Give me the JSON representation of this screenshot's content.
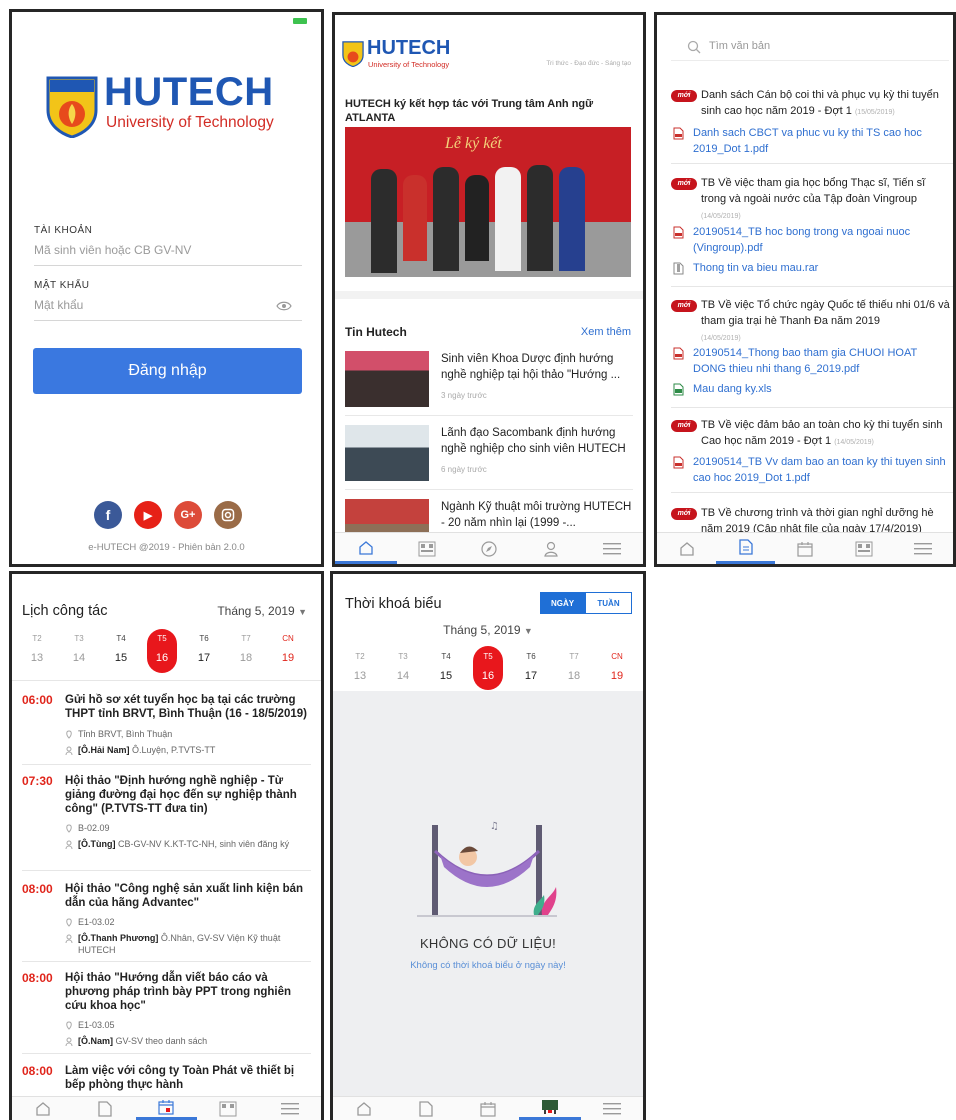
{
  "login": {
    "logo_brand": "HUTECH",
    "logo_sub": "University of Technology",
    "seal_text": "HUTECH University",
    "account_label": "TÀI KHOẢN",
    "account_placeholder": "Mã sinh viên hoặc CB GV-NV",
    "password_label": "MẬT KHẨU",
    "password_placeholder": "Mật khẩu",
    "login_button": "Đăng nhập",
    "footer": "e-HUTECH @2019 - Phiên bản 2.0.0",
    "colors": {
      "brand_blue": "#1f57b3",
      "button": "#3a78e0",
      "facebook": "#3b5998",
      "youtube": "#e62117",
      "google": "#dd4b39",
      "instagram": "#9a6b47"
    }
  },
  "news": {
    "brand": "HUTECH",
    "brand_sub": "University of Technology",
    "tagline": "Tri thức - Đạo đức - Sáng tạo",
    "headline": "HUTECH ký kết hợp tác với Trung tâm Anh ngữ ATLANTA",
    "banner_text": "Lễ ký kết",
    "section_title": "Tin Hutech",
    "see_more": "Xem thêm",
    "items": [
      {
        "title": "Sinh viên Khoa Dược định hướng nghề nghiệp tại hội thảo \"Hướng ...",
        "ago": "3 ngày trước"
      },
      {
        "title": "Lãnh đạo Sacombank định hướng nghề nghiệp cho sinh viên HUTECH",
        "ago": "6 ngày trước"
      },
      {
        "title": "Ngành Kỹ thuật môi trường HUTECH - 20 năm nhìn lại (1999 -...",
        "ago": ""
      }
    ]
  },
  "docs": {
    "search_placeholder": "Tìm văn bản",
    "badge": "mới",
    "items": [
      {
        "title": "Danh sách Cán bộ coi thi và phục vụ kỳ thi tuyển sinh cao học năm 2019 - Đợt 1",
        "date": "(15/05/2019)",
        "files": [
          "Danh sach CBCT va phuc vu ky thi TS cao hoc 2019_Dot 1.pdf"
        ]
      },
      {
        "title": "TB Về việc tham gia học bổng Thạc sĩ, Tiến sĩ trong và ngoài nước của Tập đoàn Vingroup",
        "date": "(14/05/2019)",
        "files": [
          "20190514_TB hoc bong trong va ngoai nuoc (Vingroup).pdf",
          "Thong tin va bieu mau.rar"
        ]
      },
      {
        "title": "TB Về việc Tổ chức ngày Quốc tế thiếu nhi 01/6 và tham gia trại hè Thanh Đa năm 2019",
        "date": "(14/05/2019)",
        "files": [
          "20190514_Thong bao tham gia CHUOI HOAT DONG thieu nhi thang 6_2019.pdf",
          "Mau dang ky.xls"
        ]
      },
      {
        "title": "TB Về việc đảm bảo an toàn cho kỳ thi tuyển sinh Cao học năm 2019 - Đợt 1",
        "date": "(14/05/2019)",
        "files": [
          "20190514_TB Vv dam bao an toan ky thi tuyen sinh cao hoc 2019_Dot 1.pdf"
        ]
      },
      {
        "title": "TB Về chương trình và thời gian nghỉ dưỡng hè năm 2019 (Cập nhật file của ngày 17/4/2019)",
        "date": "",
        "files": []
      }
    ]
  },
  "calendar": {
    "title": "Lịch công tác",
    "month": "Tháng 5, 2019",
    "week": {
      "days": [
        "T2",
        "T3",
        "T4",
        "T5",
        "T6",
        "T7",
        "CN"
      ],
      "dates": [
        "13",
        "14",
        "15",
        "16",
        "17",
        "18",
        "19"
      ]
    },
    "events": [
      {
        "time": "06:00",
        "title": "Gửi hồ sơ xét tuyển học bạ tại các trường THPT tỉnh BRVT, Bình Thuận (16 - 18/5/2019)",
        "place": "Tỉnh BRVT, Bình Thuận",
        "host": "[Ô.Hải Nam]",
        "people": "Ô.Luyện, P.TVTS-TT"
      },
      {
        "time": "07:30",
        "title": "Hội thảo \"Định hướng nghề nghiệp - Từ giảng đường đại học đến sự nghiệp thành công\" (P.TVTS-TT đưa tin)",
        "place": "B-02.09",
        "host": "[Ô.Tùng]",
        "people": "CB-GV-NV K.KT-TC-NH, sinh viên đăng ký"
      },
      {
        "time": "08:00",
        "title": "Hội thảo \"Công nghệ sản xuất linh kiện bán dẫn của hãng Advantec\"",
        "place": "E1-03.02",
        "host": "[Ô.Thanh Phương]",
        "people": "Ô.Nhân, GV-SV Viện Kỹ thuật HUTECH"
      },
      {
        "time": "08:00",
        "title": "Hội thảo \"Hướng dẫn viết báo cáo và phương pháp trình bày PPT trong nghiên cứu khoa học\"",
        "place": "E1-03.05",
        "host": "[Ô.Nam]",
        "people": "GV-SV theo danh sách"
      },
      {
        "time": "08:00",
        "title": "Làm việc với công ty Toàn Phát về thiết bị bếp phòng thực hành",
        "place": "",
        "host": "",
        "people": ""
      }
    ]
  },
  "timetable": {
    "title": "Thời khoá biểu",
    "seg_day": "NGÀY",
    "seg_week": "TUẦN",
    "month": "Tháng 5, 2019",
    "week": {
      "days": [
        "T2",
        "T3",
        "T4",
        "T5",
        "T6",
        "T7",
        "CN"
      ],
      "dates": [
        "13",
        "14",
        "15",
        "16",
        "17",
        "18",
        "19"
      ]
    },
    "empty_title": "KHÔNG CÓ DỮ LIỆU!",
    "empty_sub": "Không có thời khoá biểu ở ngày này!"
  }
}
